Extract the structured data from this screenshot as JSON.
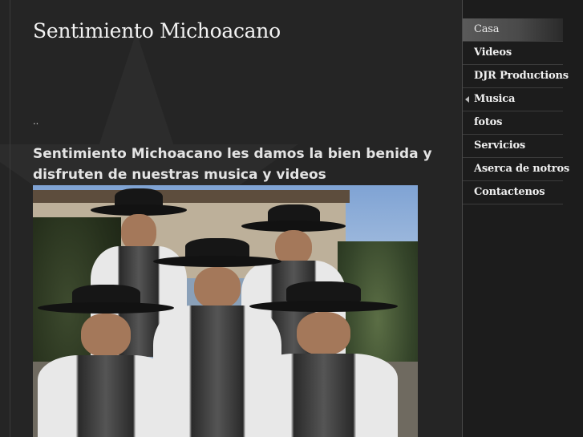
{
  "site": {
    "title": "Sentimiento Michoacano"
  },
  "content": {
    "dots": "..",
    "welcome_line1": "Sentimiento Michoacano les damos la bien benida  y",
    "welcome_line2": "disfruten  de nuestras musica y videos",
    "photo_description": ""
  },
  "nav": {
    "items": [
      {
        "label": "Casa",
        "active": true
      },
      {
        "label": "Videos"
      },
      {
        "label": "DJR Productions"
      },
      {
        "label": "Musica",
        "has_submenu": true
      },
      {
        "label": "fotos"
      },
      {
        "label": "Servicios"
      },
      {
        "label": "Aserca de notros"
      },
      {
        "label": "Contactenos"
      }
    ]
  },
  "colors": {
    "background": "#252525",
    "sidebar": "#1c1c1c",
    "text": "#f0f0f0",
    "active_item": "#5a5a5a"
  }
}
